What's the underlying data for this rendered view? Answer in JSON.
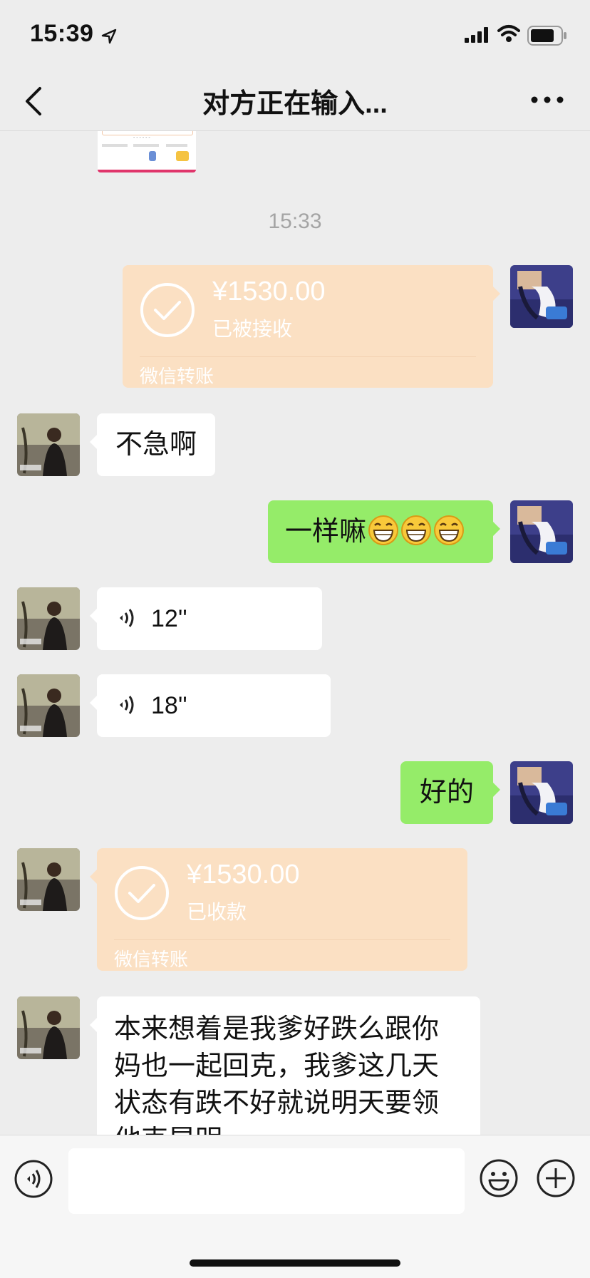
{
  "status_bar": {
    "time": "15:39"
  },
  "nav": {
    "title": "对方正在输入..."
  },
  "chat": {
    "timestamp": "15:33",
    "messages": [
      {
        "id": "m1",
        "side": "right",
        "type": "transfer",
        "amount": "¥1530.00",
        "status": "已被接收",
        "label": "微信转账"
      },
      {
        "id": "m2",
        "side": "left",
        "type": "text",
        "text": "不急啊"
      },
      {
        "id": "m3",
        "side": "right",
        "type": "text",
        "text": "一样嘛",
        "emoji": [
          "grin-icon",
          "grin-icon",
          "grin-icon"
        ]
      },
      {
        "id": "m4",
        "side": "left",
        "type": "voice",
        "duration": "12''"
      },
      {
        "id": "m5",
        "side": "left",
        "type": "voice",
        "duration": "18''"
      },
      {
        "id": "m6",
        "side": "right",
        "type": "text",
        "text": "好的"
      },
      {
        "id": "m7",
        "side": "left",
        "type": "transfer",
        "amount": "¥1530.00",
        "status": "已收款",
        "label": "微信转账"
      },
      {
        "id": "m8",
        "side": "left",
        "type": "text",
        "lines": [
          "本来想着是我爹好跌么跟你",
          "妈也一起回克，我爹这几天",
          "状态有跌不好就说明天要领",
          "他克昆明"
        ]
      }
    ]
  },
  "colors": {
    "green_bubble": "#95ec69",
    "transfer_bg": "#fbe0c3",
    "background": "#ededed"
  }
}
